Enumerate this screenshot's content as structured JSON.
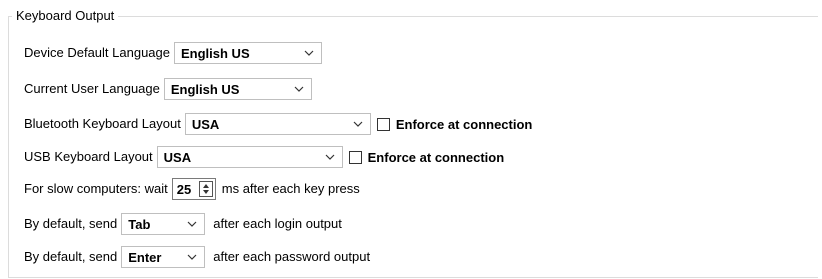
{
  "group": {
    "title": "Keyboard Output"
  },
  "device_language": {
    "label": "Device Default Language",
    "value": "English US"
  },
  "user_language": {
    "label": "Current User Language",
    "value": "English US"
  },
  "bluetooth_layout": {
    "label": "Bluetooth Keyboard Layout",
    "value": "USA",
    "enforce_label": "Enforce at connection",
    "enforce_checked": false
  },
  "usb_layout": {
    "label": "USB Keyboard Layout",
    "value": "USA",
    "enforce_label": "Enforce at connection",
    "enforce_checked": false
  },
  "slow_computers": {
    "label_before": "For slow computers: wait",
    "value": "25",
    "label_after": "ms after each key press"
  },
  "login_send": {
    "label_before": "By default, send",
    "value": "Tab",
    "label_after": "after each login output"
  },
  "password_send": {
    "label_before": "By default, send",
    "value": "Enter",
    "label_after": "after each password output"
  },
  "icons": {
    "dropdown": "chevron-down-icon",
    "spinner": "spinner-arrows-icon"
  }
}
